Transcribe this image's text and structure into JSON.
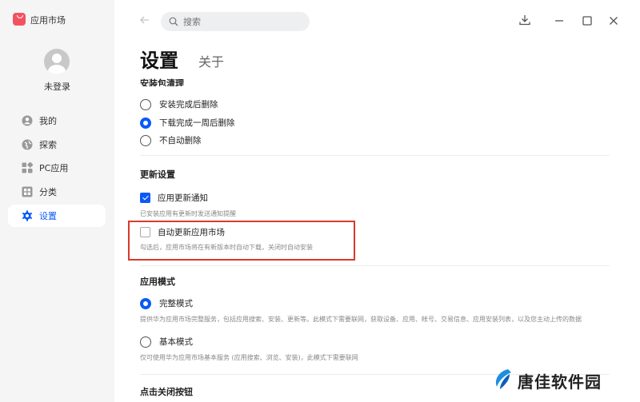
{
  "app": {
    "name": "应用市场",
    "brand_color": "#f3535f",
    "accent": "#0a59f7"
  },
  "user": {
    "login_status": "未登录"
  },
  "nav": {
    "items": [
      {
        "label": "我的",
        "icon": "user-icon",
        "active": false
      },
      {
        "label": "探索",
        "icon": "globe-icon",
        "active": false
      },
      {
        "label": "PC应用",
        "icon": "apps-grid-icon",
        "active": false
      },
      {
        "label": "分类",
        "icon": "category-icon",
        "active": false
      },
      {
        "label": "设置",
        "icon": "gear-icon",
        "active": true
      }
    ]
  },
  "header": {
    "search_placeholder": "搜索"
  },
  "page": {
    "title": "设置",
    "tab_about": "关于"
  },
  "package_cleanup": {
    "title": "安装包清理",
    "options": [
      {
        "label": "安装完成后删除",
        "selected": false
      },
      {
        "label": "下载完成一周后删除",
        "selected": true
      },
      {
        "label": "不自动删除",
        "selected": false
      }
    ]
  },
  "update_settings": {
    "title": "更新设置",
    "notify": {
      "label": "应用更新通知",
      "checked": true,
      "desc": "已安装应用有更新时发送通知提醒"
    },
    "auto_update": {
      "label": "自动更新应用市场",
      "checked": false,
      "desc": "勾选后，应用市场将在有新版本时自动下载，关闭时自动安装"
    }
  },
  "app_mode": {
    "title": "应用模式",
    "full": {
      "label": "完整模式",
      "selected": true,
      "desc": "提供华为应用市场完整服务，包括应用搜索、安装、更新等。此模式下需要联网，获取设备、应用、帐号、交易信息、应用安装列表，以及您主动上传的数据"
    },
    "basic": {
      "label": "基本模式",
      "selected": false,
      "desc": "仅可使用华为应用市场基本服务 (应用搜索、浏览、安装)，此模式下需要联网"
    }
  },
  "close_button": {
    "title": "点击关闭按钮"
  },
  "watermark": {
    "text": "唐佳软件园"
  }
}
